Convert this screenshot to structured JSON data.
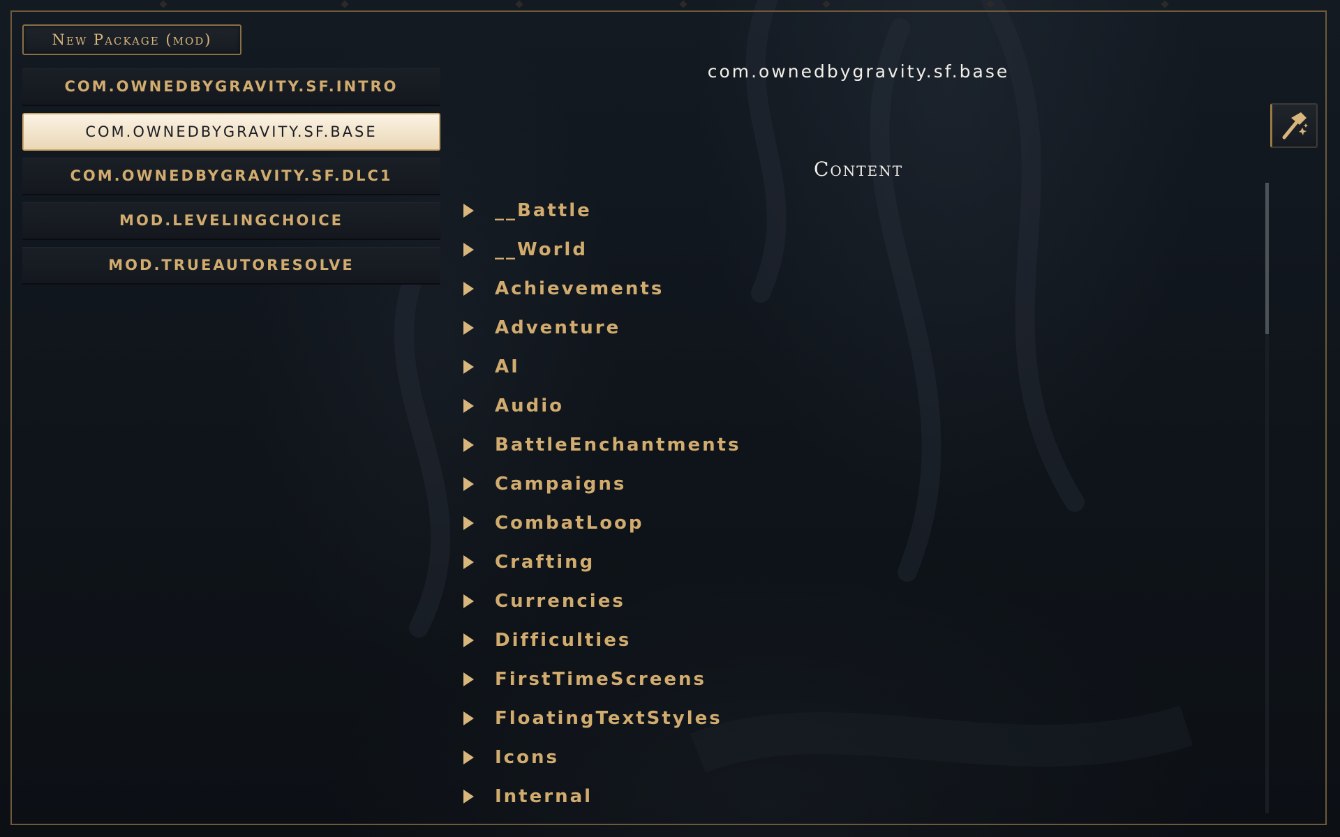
{
  "toolbar": {
    "new_package_label": "New Package (mod)"
  },
  "packages": [
    {
      "label": "COM.OWNEDBYGRAVITY.SF.INTRO",
      "selected": false
    },
    {
      "label": "COM.OWNEDBYGRAVITY.SF.BASE",
      "selected": true
    },
    {
      "label": "COM.OWNEDBYGRAVITY.SF.DLC1",
      "selected": false
    },
    {
      "label": "MOD.LEVELINGCHOICE",
      "selected": false
    },
    {
      "label": "MOD.TRUEAUTORESOLVE",
      "selected": false
    }
  ],
  "main": {
    "title": "com.ownedbygravity.sf.base",
    "content_heading": "Content",
    "tree_items": [
      {
        "label": "__Battle"
      },
      {
        "label": "__World"
      },
      {
        "label": "Achievements"
      },
      {
        "label": "Adventure"
      },
      {
        "label": "AI"
      },
      {
        "label": "Audio"
      },
      {
        "label": "BattleEnchantments"
      },
      {
        "label": "Campaigns"
      },
      {
        "label": "CombatLoop"
      },
      {
        "label": "Crafting"
      },
      {
        "label": "Currencies"
      },
      {
        "label": "Difficulties"
      },
      {
        "label": "FirstTimeScreens"
      },
      {
        "label": "FloatingTextStyles"
      },
      {
        "label": "Icons"
      },
      {
        "label": "Internal"
      }
    ]
  },
  "tool_button": {
    "icon": "hammer-icon"
  },
  "scrollbar": {
    "position_fraction": 0,
    "visible_fraction": 0.24
  },
  "colors": {
    "accent_gold": "#d2ac6e",
    "selected_bg": "#f5e9d3",
    "background": "#11161c",
    "title_text": "#f2efe9"
  }
}
